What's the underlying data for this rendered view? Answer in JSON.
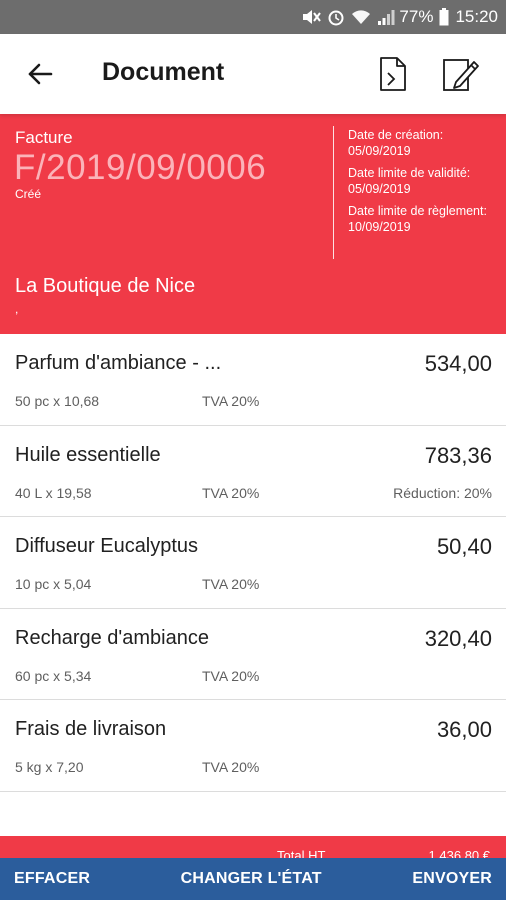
{
  "status_bar": {
    "battery": "77%",
    "time": "15:20",
    "icons": [
      "mute-icon",
      "alarm-icon",
      "wifi-icon",
      "signal-icon",
      "battery-icon"
    ]
  },
  "app_bar": {
    "title": "Document",
    "back_icon": "arrow-left-icon",
    "doc_icon": "document-icon",
    "edit_icon": "edit-icon"
  },
  "header": {
    "type": "Facture",
    "number": "F/2019/09/0006",
    "status": "Créé",
    "dates": [
      {
        "label": "Date de création:",
        "value": "05/09/2019"
      },
      {
        "label": "Date limite de validité:",
        "value": "05/09/2019"
      },
      {
        "label": "Date limite de règlement:",
        "value": "10/09/2019"
      }
    ],
    "client": "La Boutique de Nice",
    "client_sub": ",",
    "color": "#f03a47"
  },
  "items": [
    {
      "name": "Parfum d'ambiance - ...",
      "amount": "534,00",
      "qty": "50 pc x 10,68",
      "tva": "TVA 20%",
      "discount": ""
    },
    {
      "name": "Huile essentielle",
      "amount": "783,36",
      "qty": "40 L x 19,58",
      "tva": "TVA 20%",
      "discount": "Réduction: 20%"
    },
    {
      "name": "Diffuseur Eucalyptus",
      "amount": "50,40",
      "qty": "10 pc x 5,04",
      "tva": "TVA 20%",
      "discount": ""
    },
    {
      "name": "Recharge d'ambiance",
      "amount": "320,40",
      "qty": "60 pc x 5,34",
      "tva": "TVA 20%",
      "discount": ""
    },
    {
      "name": "Frais de livraison",
      "amount": "36,00",
      "qty": "5 kg x 7,20",
      "tva": "TVA 20%",
      "discount": ""
    }
  ],
  "totals": {
    "label": "Total HT",
    "value": "1 436,80 €"
  },
  "actions": {
    "erase": "EFFACER",
    "change_state": "CHANGER L'ÉTAT",
    "send": "ENVOYER",
    "color": "#2b5d9c"
  }
}
